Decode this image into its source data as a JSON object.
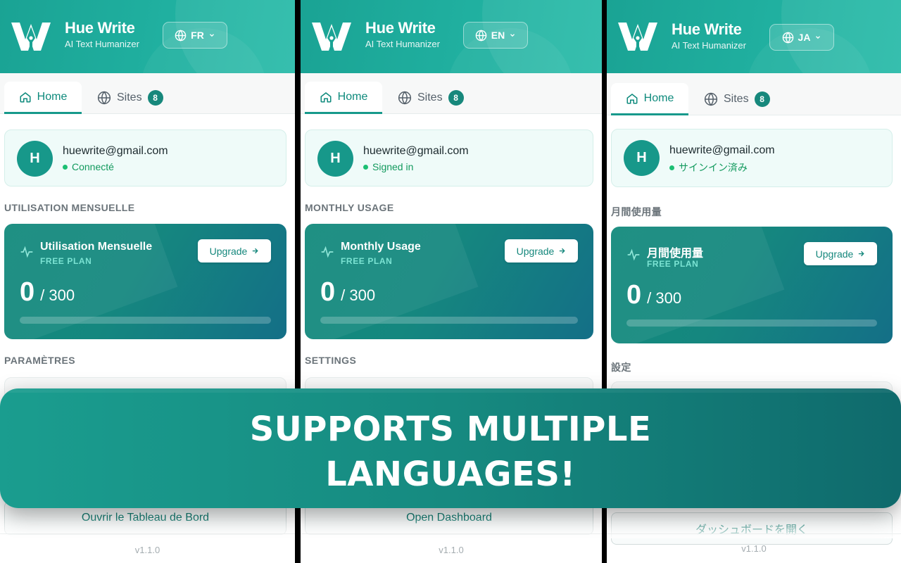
{
  "app": {
    "name": "Hue Write",
    "tagline": "AI Text Humanizer",
    "version": "v1.1.0"
  },
  "colors": {
    "brand": "#1aa394",
    "accent_dark": "#146f87",
    "status_green": "#1cbf73"
  },
  "panels": [
    {
      "lang_code": "FR",
      "tabs": {
        "home": "Home",
        "sites": "Sites",
        "sites_count": "8"
      },
      "account": {
        "avatar_initial": "H",
        "email": "huewrite@gmail.com",
        "status": "Connecté"
      },
      "usage_section_label": "UTILISATION MENSUELLE",
      "usage": {
        "title": "Utilisation Mensuelle",
        "plan": "FREE PLAN",
        "upgrade": "Upgrade",
        "used": "0",
        "limit": "/ 300",
        "progress_fraction": 0
      },
      "settings_section_label": "PARAMÈTRES",
      "dashboard_button": "Ouvrir le Tableau de Bord"
    },
    {
      "lang_code": "EN",
      "tabs": {
        "home": "Home",
        "sites": "Sites",
        "sites_count": "8"
      },
      "account": {
        "avatar_initial": "H",
        "email": "huewrite@gmail.com",
        "status": "Signed in"
      },
      "usage_section_label": "MONTHLY USAGE",
      "usage": {
        "title": "Monthly Usage",
        "plan": "FREE PLAN",
        "upgrade": "Upgrade",
        "used": "0",
        "limit": "/ 300",
        "progress_fraction": 0
      },
      "settings_section_label": "SETTINGS",
      "dashboard_button": "Open Dashboard"
    },
    {
      "lang_code": "JA",
      "tabs": {
        "home": "Home",
        "sites": "Sites",
        "sites_count": "8"
      },
      "account": {
        "avatar_initial": "H",
        "email": "huewrite@gmail.com",
        "status": "サインイン済み"
      },
      "usage_section_label": "月間使用量",
      "usage": {
        "title": "月間使用量",
        "plan": "FREE PLAN",
        "upgrade": "Upgrade",
        "used": "0",
        "limit": "/ 300",
        "progress_fraction": 0
      },
      "settings_section_label": "設定",
      "dashboard_button": "ダッシュボードを開く"
    }
  ],
  "banner": {
    "text": "SUPPORTS MULTIPLE\nLANGUAGES!"
  }
}
